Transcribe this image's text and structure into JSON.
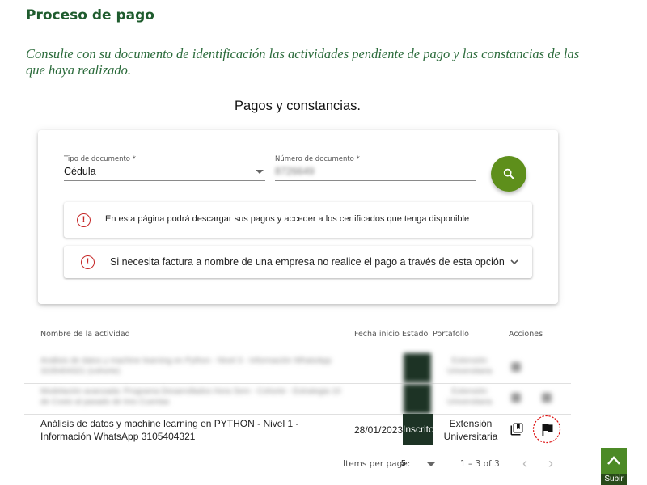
{
  "page": {
    "title": "Proceso de pago",
    "intro": "Consulte con su documento de identificación las actividades pendiente de pago y las constancias de las que haya realizado.",
    "section_title": "Pagos y constancias."
  },
  "form": {
    "doctype_label": "Tipo de documento *",
    "doctype_value": "Cédula",
    "docnum_label": "Número de documento *",
    "docnum_value": "8726649"
  },
  "notices": [
    {
      "text": "En esta página podrá descargar sus pagos y acceder a los certificados que tenga disponible",
      "icon": "alert-circle-icon"
    },
    {
      "text": "Si necesita factura a nombre de una empresa no realice el pago a través de esta opción",
      "icon": "alert-circle-icon"
    }
  ],
  "table": {
    "headers": [
      "Nombre de la actividad",
      "Fecha inicio",
      "Estado",
      "Portafollo",
      "Acciones"
    ],
    "rows": [
      {
        "name": "Análisis de datos y machine learning en Python - Nivel 3 - Información WhatsApp 3105404321 (cohorte)",
        "date": "",
        "status": "",
        "portfolio": "Extensión Universitaria"
      },
      {
        "name": "Modelación avanzada: Programa Desarrollados Hora Sem - Cohorte - Estrategia 10 de Costo al pasado de tres Cuentas",
        "date": "",
        "status": "",
        "portfolio": "Extensión Universitaria"
      },
      {
        "name": "Análisis de datos y machine learning en PYTHON - Nivel 1 - Información WhatsApp 3105404321",
        "date": "28/01/2023",
        "status": "Inscrito",
        "portfolio": "Extensión Universitaria"
      }
    ]
  },
  "pagination": {
    "items_label": "Items per page:",
    "page_size": "5",
    "range": "1 – 3 of 3"
  },
  "scroll_top": {
    "label": "Subir"
  },
  "colors": {
    "title": "#1f5c2e",
    "accent": "#5e8f1b",
    "status": "#1d3325",
    "alert": "#c62828"
  }
}
